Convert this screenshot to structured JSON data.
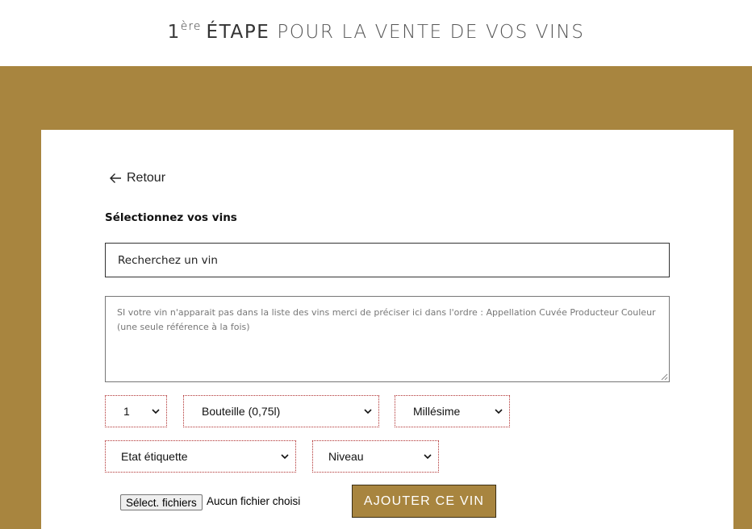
{
  "header": {
    "step_number": "1",
    "step_suffix": "ère",
    "step_word": "ÉTAPE",
    "title_rest": "POUR LA VENTE DE VOS VINS"
  },
  "form": {
    "back_label": "Retour",
    "section_title": "Sélectionnez vos vins",
    "search_placeholder": "Recherchez un vin",
    "notes_placeholder": "SI votre vin n'apparait pas dans la liste des vins merci de préciser ici dans l'ordre : Appellation Cuvée Producteur Couleur (une seule référence à la fois)",
    "quantity_value": "1",
    "container_value": "Bouteille (0,75l)",
    "vintage_value": "Millésime",
    "label_condition_value": "Etat étiquette",
    "level_value": "Niveau",
    "file_button_label": "Sélect. fichiers",
    "file_status": "Aucun fichier choisi",
    "add_button_label": "AJOUTER CE VIN"
  },
  "colors": {
    "brand_gold": "#a8853f",
    "select_border": "#b03030"
  }
}
